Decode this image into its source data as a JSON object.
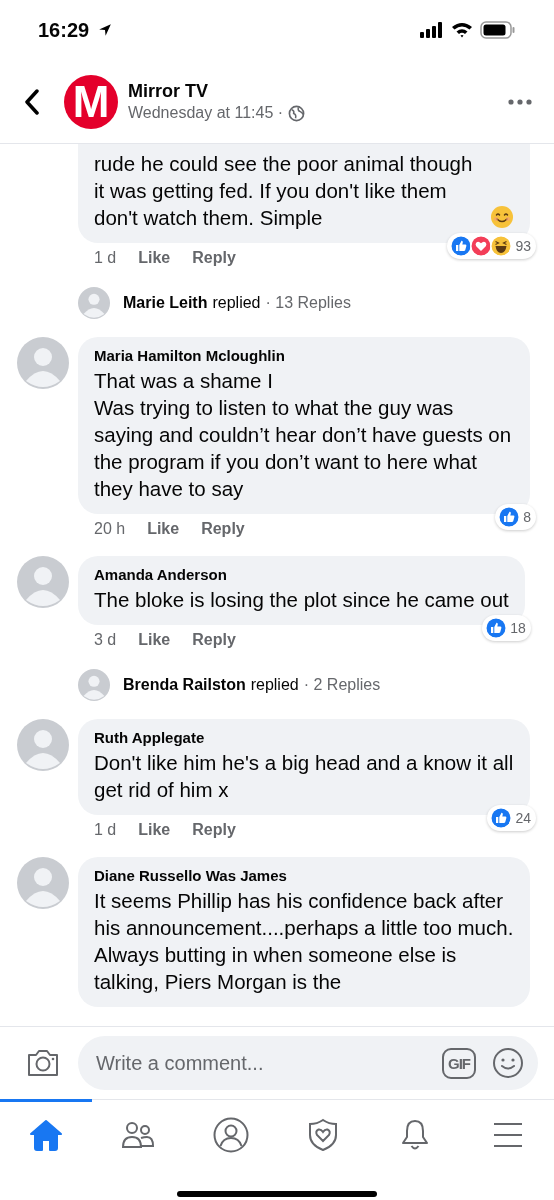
{
  "status_bar": {
    "time": "16:29"
  },
  "header": {
    "logo_letter": "M",
    "page_name": "Mirror TV",
    "timestamp": "Wednesday at 11:45 ·"
  },
  "comments": [
    {
      "cut_top": true,
      "text": "rude he could see the poor animal though it was getting fed. If you don't like them don't watch them. Simple",
      "emoji": {
        "kind": "smile"
      },
      "time": "1 d",
      "actions": [
        "Like",
        "Reply"
      ],
      "reactions": [
        {
          "kind": "like"
        },
        {
          "kind": "love"
        },
        {
          "kind": "haha"
        }
      ],
      "reaction_count": "93",
      "replies": {
        "name": "Marie Leith",
        "verb": "replied",
        "count": "· 13 Replies"
      }
    },
    {
      "cut_top": false,
      "author": "Maria Hamilton Mcloughlin",
      "text": "That was a shame I\nWas trying to listen to what the guy was saying and couldn’t hear don’t have guests on the program if you don’t want to here what they have to say",
      "time": "20 h",
      "actions": [
        "Like",
        "Reply"
      ],
      "reactions": [
        {
          "kind": "like"
        }
      ],
      "reaction_count": "8"
    },
    {
      "cut_top": false,
      "author": "Amanda Anderson",
      "text": "The bloke is losing the plot since he came out",
      "time": "3 d",
      "actions": [
        "Like",
        "Reply"
      ],
      "reactions": [
        {
          "kind": "like"
        }
      ],
      "reaction_count": "18",
      "replies": {
        "name": "Brenda Railston",
        "verb": "replied",
        "count": "· 2 Replies"
      }
    },
    {
      "cut_top": false,
      "author": "Ruth Applegate",
      "text": "Don't like him he's a big head and a know it all get rid of him x",
      "time": "1 d",
      "actions": [
        "Like",
        "Reply"
      ],
      "reactions": [
        {
          "kind": "like"
        }
      ],
      "reaction_count": "24"
    },
    {
      "cut_top": false,
      "author": "Diane Russello Was James",
      "text": "It seems Phillip has his confidence back after his announcement....perhaps a little too much. Always butting in when someone else is talking,  Piers Morgan is the"
    }
  ],
  "composer": {
    "placeholder": "Write a comment...",
    "gif_label": "GIF"
  },
  "nav": [
    {
      "kind": "home",
      "selected": true
    },
    {
      "kind": "friends",
      "selected": false
    },
    {
      "kind": "profile",
      "selected": false
    },
    {
      "kind": "shield",
      "selected": false
    },
    {
      "kind": "bell",
      "selected": false
    },
    {
      "kind": "menu",
      "selected": false
    }
  ]
}
